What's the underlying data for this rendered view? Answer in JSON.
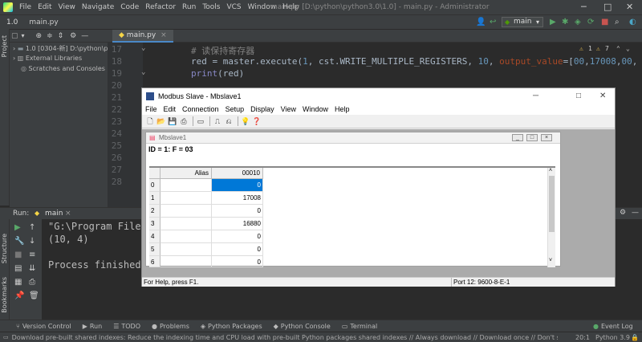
{
  "ide": {
    "menu": [
      "File",
      "Edit",
      "View",
      "Navigate",
      "Code",
      "Refactor",
      "Run",
      "Tools",
      "VCS",
      "Window",
      "Help"
    ],
    "window_title": "main.py [D:\\python\\python3.0\\1.0] - main.py - Administrator",
    "nav": {
      "project": "1.0",
      "file": "main.py"
    },
    "run_config": "main",
    "inspection": {
      "warnings": "1",
      "weak": "7"
    },
    "project_panel": {
      "title": "Project",
      "items": [
        "1.0 [0304-新]  D:\\python\\p",
        "External Libraries",
        "Scratches and Consoles"
      ]
    },
    "editor": {
      "tab": "main.py",
      "lines": [
        {
          "num": "17",
          "comment": "# 读保持寄存器"
        },
        {
          "num": "18",
          "a": "red = master.execute(",
          "b": "1",
          "c": ", cst.WRITE_MULTIPLE_REGISTERS, ",
          "d": "10",
          "e": ", ",
          "f": "output_value",
          "g": "=[",
          "h": "00",
          "i": ",",
          "j": "17008",
          "k": ",",
          "l": "00",
          "m": ","
        },
        {
          "num": "19",
          "fn": "print",
          "rest": "(red)"
        },
        {
          "num": "20"
        },
        {
          "num": "21"
        },
        {
          "num": "22"
        },
        {
          "num": "23"
        },
        {
          "num": "24"
        },
        {
          "num": "25"
        },
        {
          "num": "26"
        },
        {
          "num": "27"
        },
        {
          "num": "28"
        }
      ]
    },
    "run_panel": {
      "label": "Run:",
      "tab": "main",
      "output": [
        "\"G:\\Program Files",
        "(10, 4)",
        "",
        "Process finished w"
      ]
    },
    "side_labels": {
      "structure": "Structure",
      "bookmarks": "Bookmarks"
    },
    "bottom_tabs": [
      "Version Control",
      "Run",
      "TODO",
      "Problems",
      "Python Packages",
      "Python Console",
      "Terminal"
    ],
    "event_log": "Event Log",
    "status": {
      "message": "Download pre-built shared indexes: Reduce the indexing time and CPU load with pre-built Python packages shared indexes // Always download // Download once // Don't sho... (a minute ac",
      "position": "20:1",
      "python": "Python 3.9"
    }
  },
  "modbus": {
    "title": "Modbus Slave - Mbslave1",
    "menu": [
      "File",
      "Edit",
      "Connection",
      "Setup",
      "Display",
      "View",
      "Window",
      "Help"
    ],
    "child_title": "Mbslave1",
    "id_line": "ID = 1: F = 03",
    "columns": {
      "alias": "Alias",
      "address": "00010"
    },
    "rows": [
      {
        "idx": "0",
        "value": "0"
      },
      {
        "idx": "1",
        "value": "17008"
      },
      {
        "idx": "2",
        "value": "0"
      },
      {
        "idx": "3",
        "value": "16880"
      },
      {
        "idx": "4",
        "value": "0"
      },
      {
        "idx": "5",
        "value": "0"
      },
      {
        "idx": "6",
        "value": "0"
      }
    ],
    "status_left": "For Help, press F1.",
    "status_right": "Port 12: 9600-8-E-1"
  }
}
